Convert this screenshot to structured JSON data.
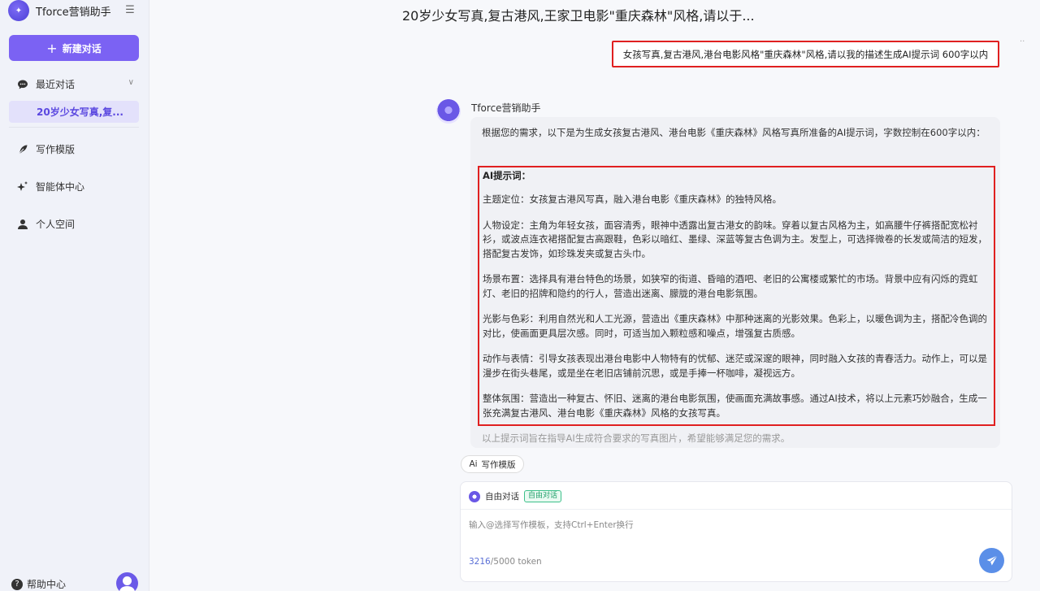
{
  "sidebar": {
    "app_name": "Tforce营销助手",
    "new_chat_label": "新建对话",
    "recent_label": "最近对话",
    "recent_conversation": "20岁少女写真,复...",
    "nav": {
      "writing_template": "写作模版",
      "agent_center": "智能体中心",
      "personal_space": "个人空间"
    },
    "help_label": "帮助中心"
  },
  "conversation": {
    "title": "20岁少女写真,复古港风,王家卫电影\"重庆森林\"风格,请以于...",
    "user_message": "女孩写真,复古港风,港台电影风格\"重庆森林\"风格,请以我的描述生成AI提示词 600字以内",
    "bot_name": "Tforce营销助手",
    "bot_intro": "根据您的需求，以下是为生成女孩复古港风、港台电影《重庆森林》风格写真所准备的AI提示词，字数控制在600字以内：",
    "prompt_heading": "AI提示词：",
    "prompt_paragraphs": [
      "主题定位：女孩复古港风写真，融入港台电影《重庆森林》的独特风格。",
      "人物设定：主角为年轻女孩，面容清秀，眼神中透露出复古港女的韵味。穿着以复古风格为主，如高腰牛仔裤搭配宽松衬衫，或波点连衣裙搭配复古高跟鞋，色彩以暗红、墨绿、深蓝等复古色调为主。发型上，可选择微卷的长发或简洁的短发，搭配复古发饰，如珍珠发夹或复古头巾。",
      "场景布置：选择具有港台特色的场景，如狭窄的街道、昏暗的酒吧、老旧的公寓楼或繁忙的市场。背景中应有闪烁的霓虹灯、老旧的招牌和隐约的行人，营造出迷离、朦胧的港台电影氛围。",
      "光影与色彩：利用自然光和人工光源，营造出《重庆森林》中那种迷离的光影效果。色彩上，以暖色调为主，搭配冷色调的对比，使画面更具层次感。同时，可适当加入颗粒感和噪点，增强复古质感。",
      "动作与表情：引导女孩表现出港台电影中人物特有的忧郁、迷茫或深邃的眼神，同时融入女孩的青春活力。动作上，可以是漫步在街头巷尾，或是坐在老旧店铺前沉思，或是手捧一杯咖啡，凝视远方。",
      "整体氛围：营造出一种复古、怀旧、迷离的港台电影氛围，使画面充满故事感。通过AI技术，将以上元素巧妙融合，生成一张充满复古港风、港台电影《重庆森林》风格的女孩写真。"
    ],
    "bot_outro": "以上提示词旨在指导AI生成符合要求的写真图片，希望能够满足您的需求。"
  },
  "composer": {
    "template_chip_prefix": "Ai",
    "template_chip_label": "写作模版",
    "mode_label": "自由对话",
    "mode_badge": "自由对话",
    "placeholder": "输入@选择写作模板，支持Ctrl+Enter换行",
    "token_used": "3216",
    "token_total": "/5000 token"
  },
  "colors": {
    "accent": "#7b62f3",
    "highlight_border": "#e02020",
    "send_button": "#5b8fe8"
  }
}
